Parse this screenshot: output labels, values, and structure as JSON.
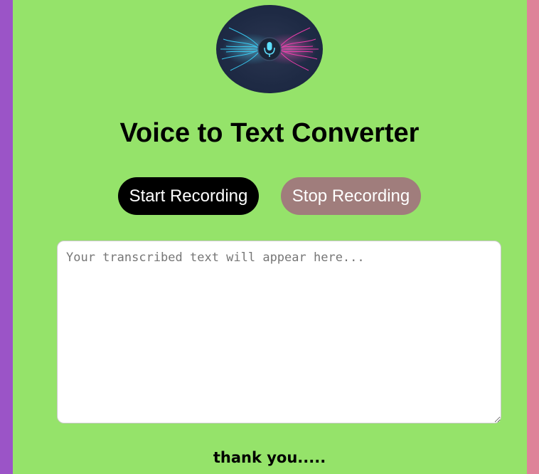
{
  "header": {
    "logo_icon": "microphone-sound-wave-icon",
    "title": "Voice to Text Converter"
  },
  "controls": {
    "start_label": "Start Recording",
    "stop_label": "Stop Recording"
  },
  "transcript": {
    "value": "",
    "placeholder": "Your transcribed text will appear here..."
  },
  "footer": {
    "text": "thank you....."
  },
  "colors": {
    "page_background": "#95e36a",
    "left_strip": "#9b54c7",
    "right_strip": "#de8399",
    "start_button": "#000000",
    "stop_button": "#a07d7c",
    "logo_cyan": "#39d6ff",
    "logo_magenta": "#ff3fb4"
  }
}
